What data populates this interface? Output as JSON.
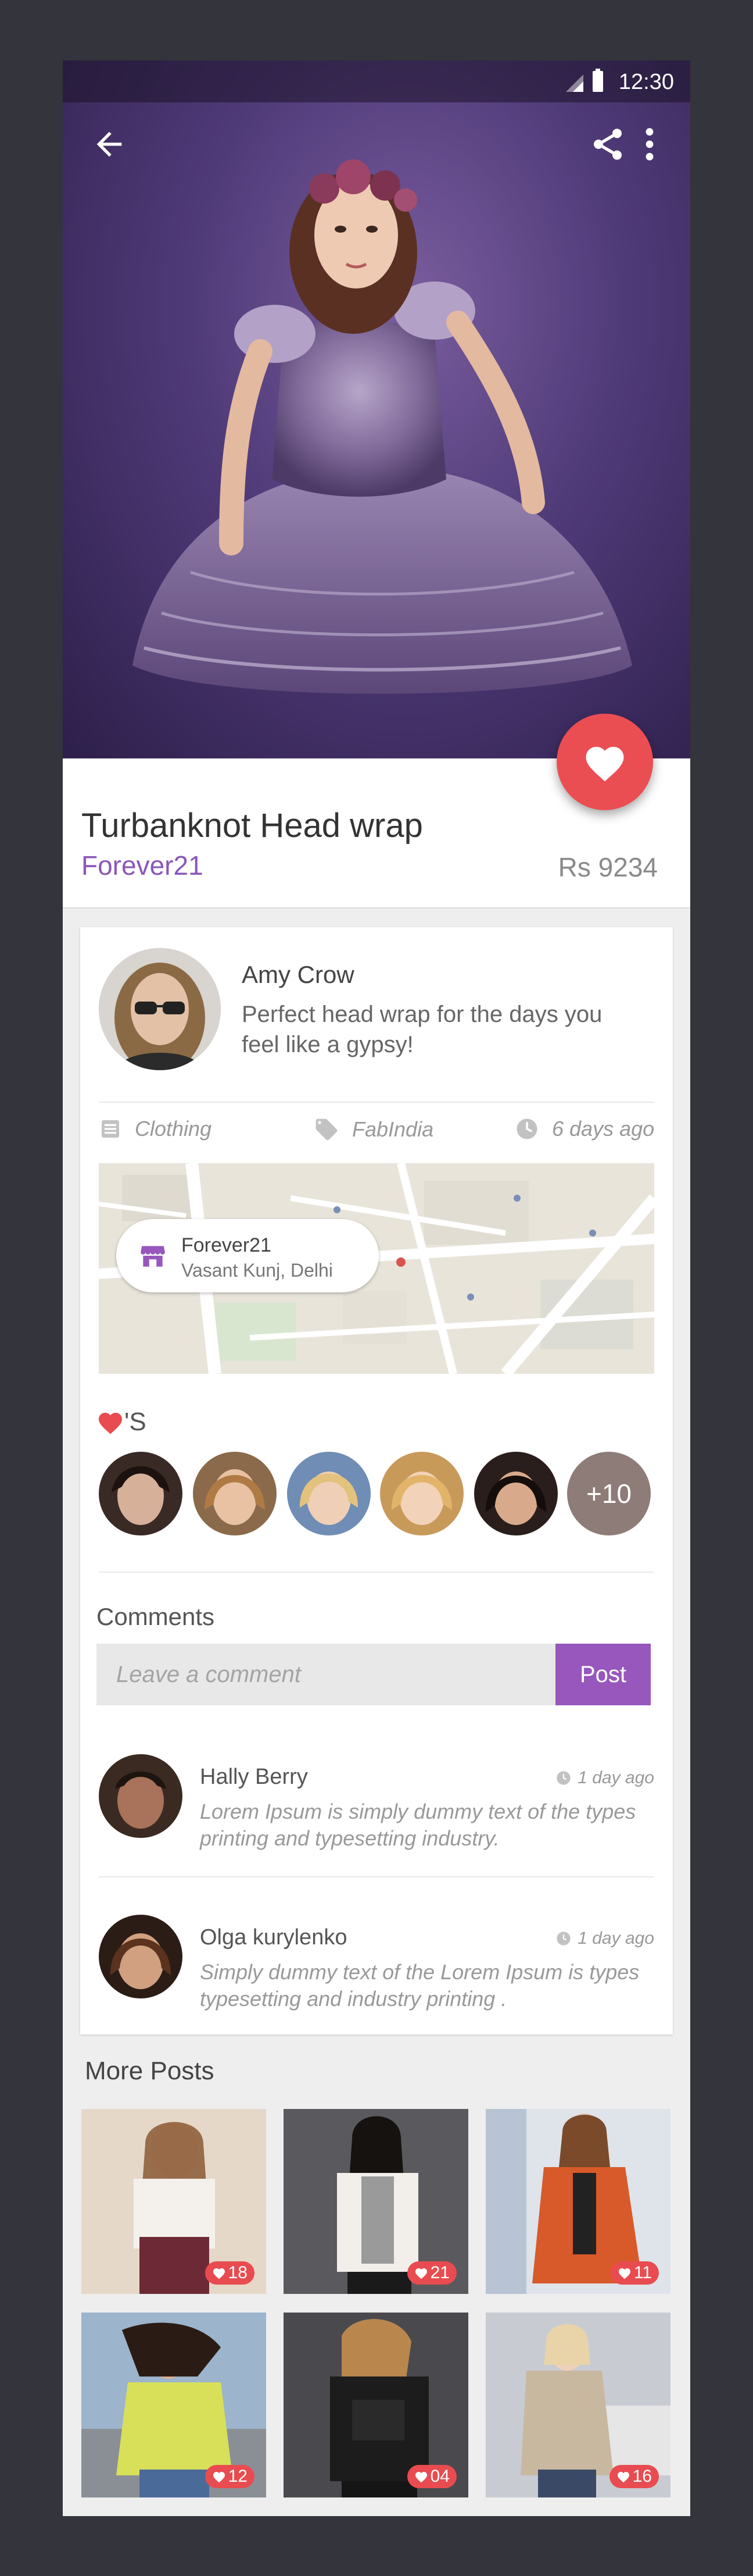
{
  "status_bar": {
    "time": "12:30"
  },
  "product": {
    "title": "Turbanknot Head wrap",
    "brand": "Forever21",
    "price": "Rs 9234"
  },
  "post": {
    "author": "Amy Crow",
    "text": "Perfect head wrap for the days you feel like a gypsy!",
    "category": "Clothing",
    "tag": "FabIndia",
    "time": "6 days ago"
  },
  "map": {
    "place": "Forever21",
    "address": "Vasant Kunj, Delhi"
  },
  "likes": {
    "heading_suffix": "'S",
    "more_count": "+10"
  },
  "comments": {
    "heading": "Comments",
    "input_placeholder": "Leave a comment",
    "post_label": "Post",
    "items": [
      {
        "name": "Hally Berry",
        "time": "1 day ago",
        "text": "Lorem Ipsum is simply dummy text of the types printing and typesetting industry."
      },
      {
        "name": "Olga kurylenko",
        "time": "1 day ago",
        "text": "Simply dummy text of the Lorem Ipsum is types typesetting and industry printing ."
      }
    ]
  },
  "more_posts": {
    "heading": "More Posts",
    "items": [
      {
        "likes": "18"
      },
      {
        "likes": "21"
      },
      {
        "likes": "11"
      },
      {
        "likes": "12"
      },
      {
        "likes": "04"
      },
      {
        "likes": "16"
      }
    ]
  },
  "colors": {
    "accent_purple": "#9757bd",
    "brand_purple": "#8c56b8",
    "heart_red": "#ea4e52",
    "background": "#34343c"
  }
}
